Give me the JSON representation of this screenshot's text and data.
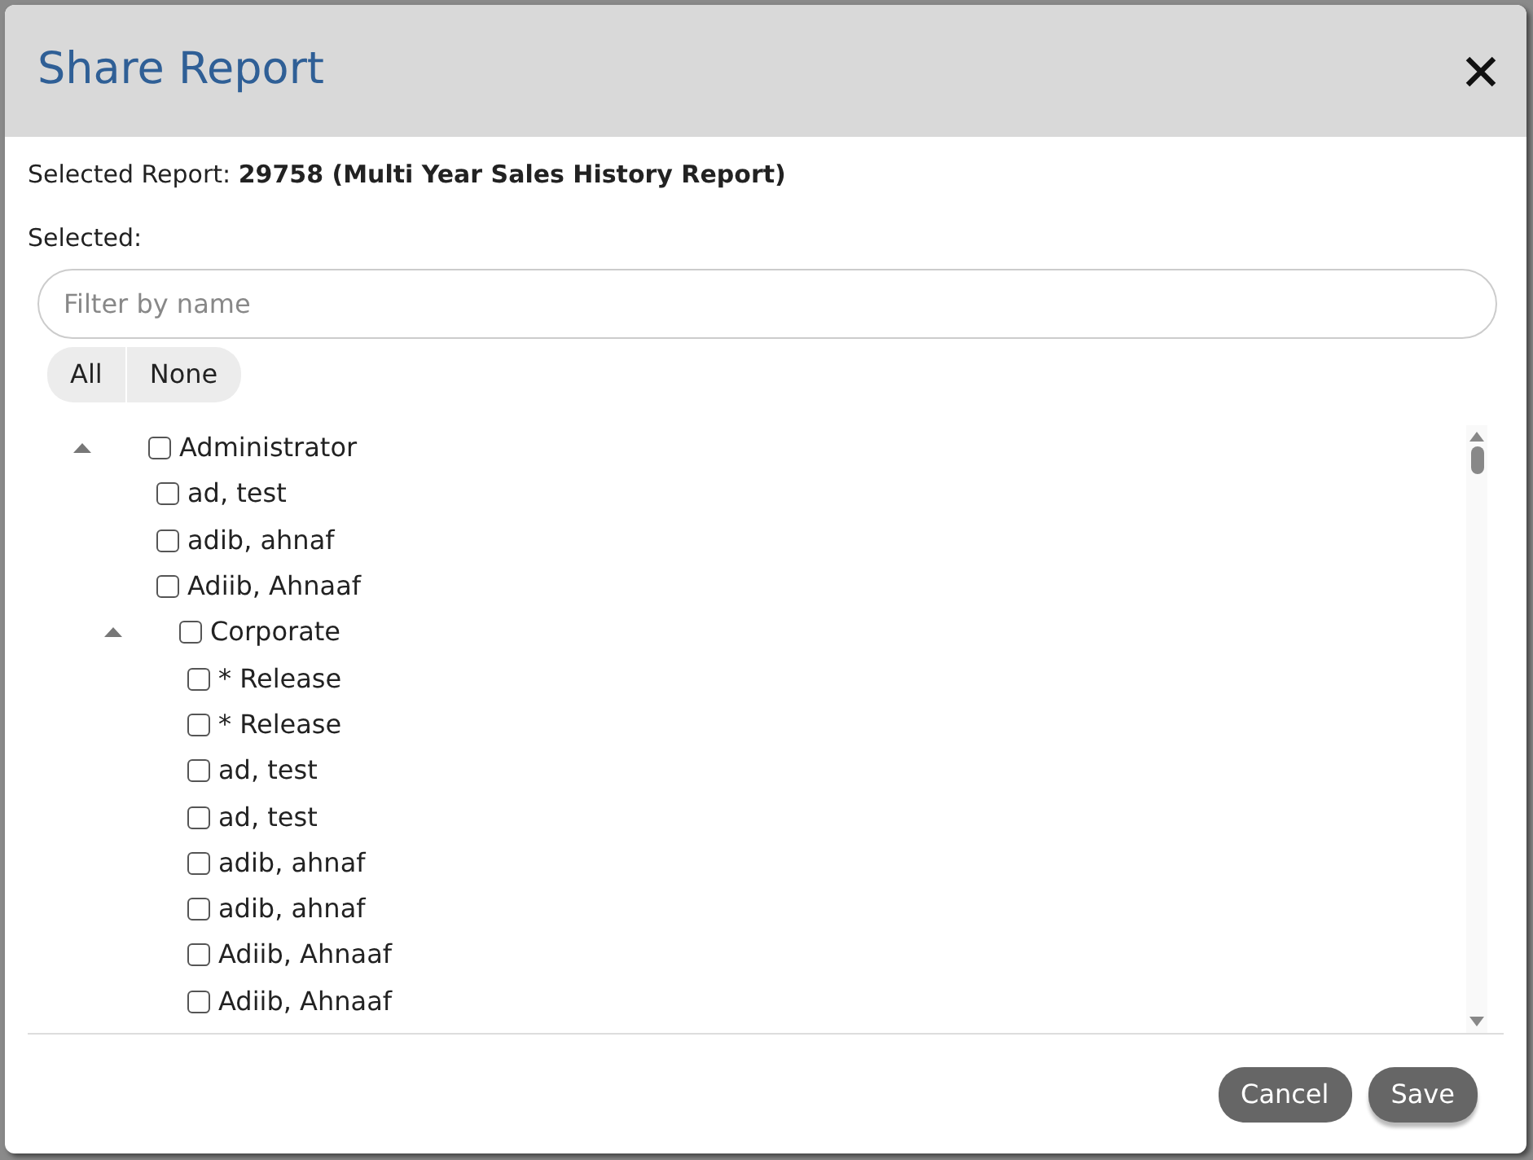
{
  "dialog": {
    "title": "Share Report"
  },
  "selected_report": {
    "label": "Selected Report:",
    "value": "29758 (Multi Year Sales History Report)"
  },
  "selected_label": "Selected:",
  "filter": {
    "placeholder": "Filter by name"
  },
  "quick_select": [
    "All",
    "None"
  ],
  "tree": [
    {
      "label": "Administrator",
      "checked": false,
      "expanded": true,
      "children": [
        {
          "label": "ad, test",
          "checked": false
        },
        {
          "label": "adib, ahnaf",
          "checked": false
        },
        {
          "label": "Adiib, Ahnaaf",
          "checked": false
        },
        {
          "label": "Corporate",
          "checked": false,
          "expanded": true,
          "children": [
            {
              "label": "* Release",
              "checked": false
            },
            {
              "label": "* Release",
              "checked": false
            },
            {
              "label": "ad, test",
              "checked": false
            },
            {
              "label": "ad, test",
              "checked": false
            },
            {
              "label": "adib, ahnaf",
              "checked": false
            },
            {
              "label": "adib, ahnaf",
              "checked": false
            },
            {
              "label": "Adiib, Ahnaaf",
              "checked": false
            },
            {
              "label": "Adiib, Ahnaaf",
              "checked": false
            }
          ]
        }
      ]
    }
  ],
  "buttons": [
    "Cancel",
    "Save"
  ]
}
